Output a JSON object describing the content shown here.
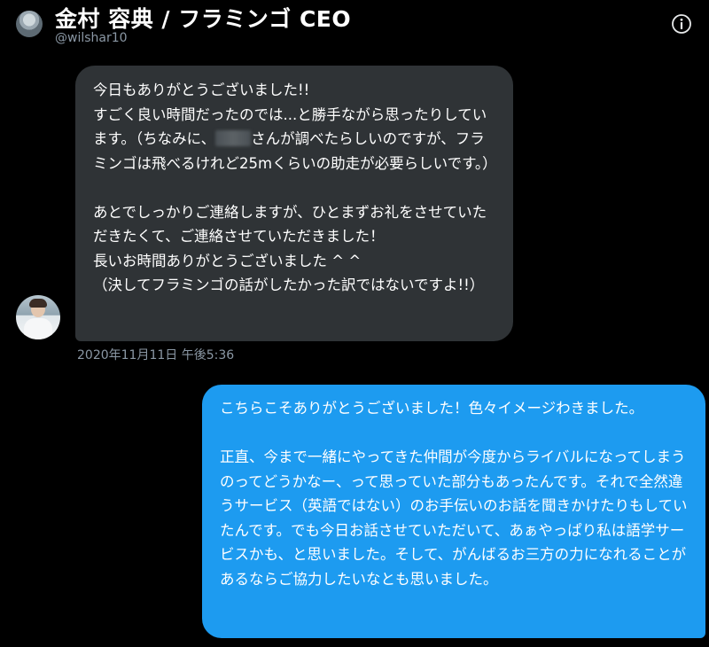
{
  "header": {
    "title": "金村 容典 / フラミンゴ CEO",
    "handle": "@wilshar10",
    "info_icon": "info-circle-icon"
  },
  "colors": {
    "background": "#000000",
    "received_bubble": "#2f3336",
    "sent_bubble": "#1d9bf0",
    "secondary_text": "#8b98a5"
  },
  "messages": [
    {
      "direction": "received",
      "text_before_redaction": "今日もありがとうございました!!\nすごく良い時間だったのでは...と勝手ながら思ったりしています。（ちなみに、",
      "text_after_redaction": "さんが調べたらしいのですが、フラミンゴは飛べるけれど25mくらいの助走が必要らしいです。）\n\nあとでしっかりご連絡しますが、ひとまずお礼をさせていただきたくて、ご連絡させていただきました！\n長いお時間ありがとうございました ^ ^\n（決してフラミンゴの話がしたかった訳ではないですよ!!）",
      "timestamp": "2020年11月11日 午後5:36"
    },
    {
      "direction": "sent",
      "text": "こちらこそありがとうございました！色々イメージわきました。\n\n正直、今まで一緒にやってきた仲間が今度からライバルになってしまうのってどうかなー、って思っていた部分もあったんです。それで全然違うサービス（英語ではない）のお手伝いのお話を聞きかけたりもしていたんです。でも今日お話させていただいて、あぁやっぱり私は語学サービスかも、と思いました。そして、がんばるお三方の力になれることがあるならご協力したいなとも思いました。"
    }
  ]
}
